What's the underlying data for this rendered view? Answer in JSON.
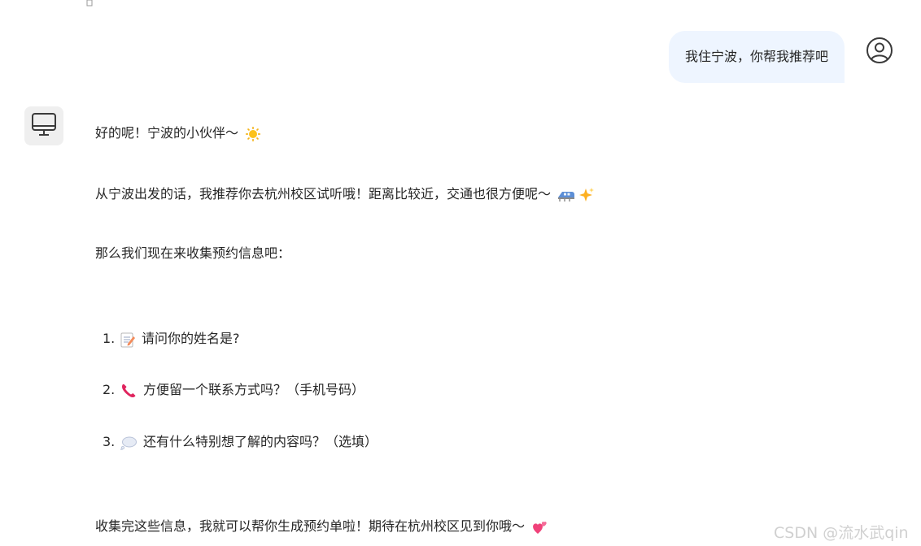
{
  "user_message": "我住宁波，你帮我推荐吧",
  "assistant": {
    "greeting": "好的呢！宁波的小伙伴～",
    "recommendation": "从宁波出发的话，我推荐你去杭州校区试听哦！距离比较近，交通也很方便呢～",
    "intro": "那么我们现在来收集预约信息吧：",
    "questions": [
      {
        "num": "1.",
        "icon": "memo-icon",
        "text": "请问你的姓名是?"
      },
      {
        "num": "2.",
        "icon": "telephone-icon",
        "text": "方便留一个联系方式吗？（手机号码）"
      },
      {
        "num": "3.",
        "icon": "speech-balloon-icon",
        "text": "还有什么特别想了解的内容吗？（选填）"
      }
    ],
    "closing": "收集完这些信息，我就可以帮你生成预约单啦！期待在杭州校区见到你哦～"
  },
  "watermark": "CSDN @流水武qin",
  "colors": {
    "user_bubble": "#eef5ff",
    "bot_avatar_bg": "#efefef",
    "text": "#262626",
    "watermark": "#d0d0d0"
  }
}
